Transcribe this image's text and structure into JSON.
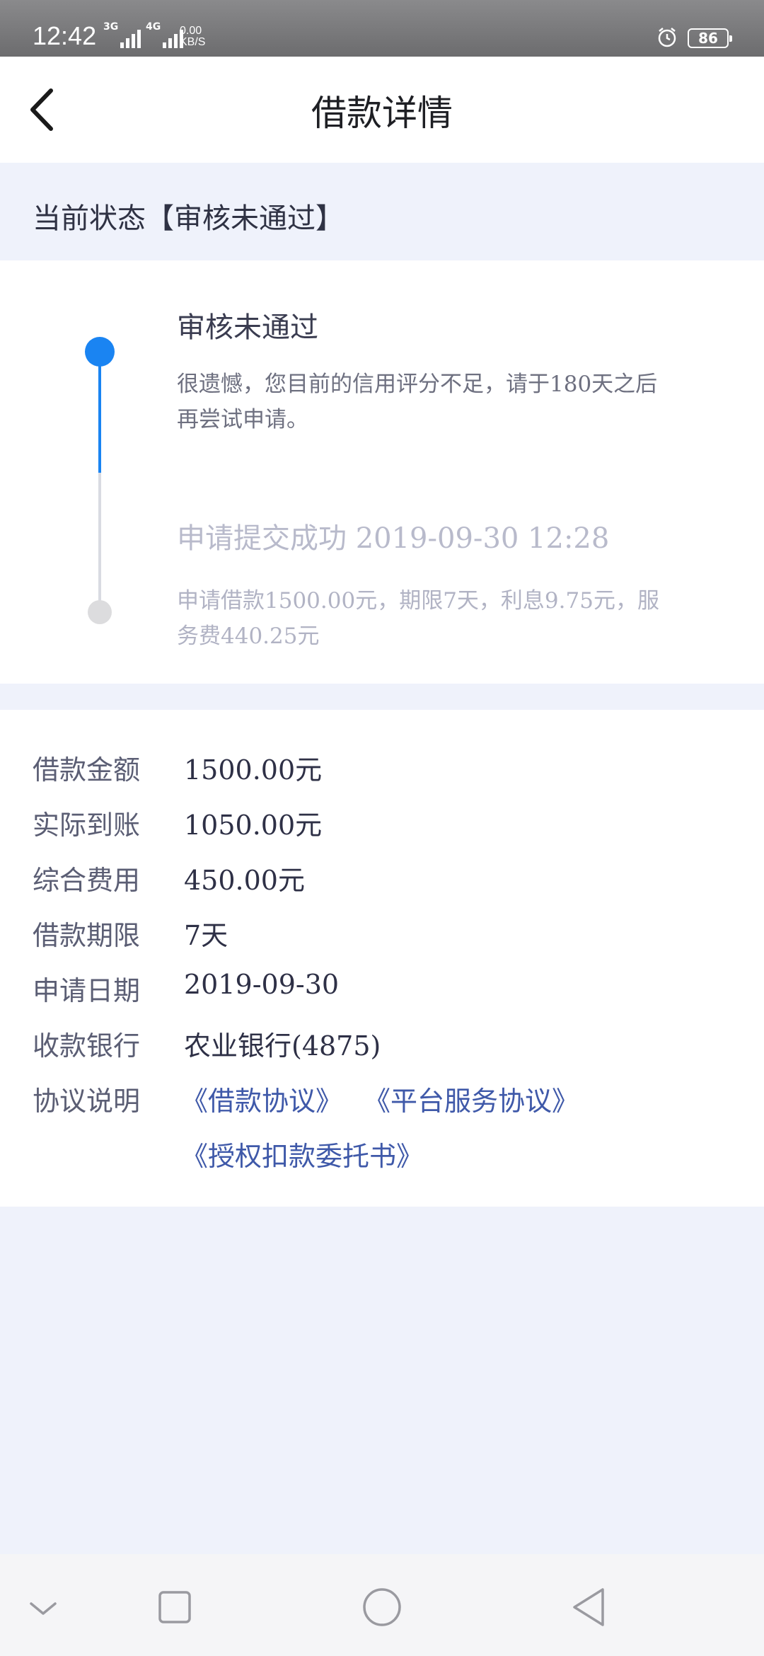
{
  "status_bar": {
    "time": "12:42",
    "network_1": "3G",
    "network_2": "4G",
    "speed_value": "0.00",
    "speed_unit": "KB/S",
    "battery": "86"
  },
  "header": {
    "title": "借款详情"
  },
  "state": {
    "text": "当前状态【审核未通过】"
  },
  "timeline": [
    {
      "title": "审核未通过",
      "desc": "很遗憾，您目前的信用评分不足，请于180天之后再尝试申请。",
      "active": true
    },
    {
      "title": "申请提交成功 2019-09-30 12:28",
      "desc": "申请借款1500.00元，期限7天，利息9.75元，服务费440.25元",
      "active": false
    }
  ],
  "details": [
    {
      "label": "借款金额",
      "value": "1500.00元"
    },
    {
      "label": "实际到账",
      "value": "1050.00元"
    },
    {
      "label": "综合费用",
      "value": "450.00元"
    },
    {
      "label": "借款期限",
      "value": "7天"
    },
    {
      "label": "申请日期",
      "value": "2019-09-30"
    },
    {
      "label": "收款银行",
      "value": "农业银行(4875)"
    }
  ],
  "agreements": {
    "label": "协议说明",
    "links": [
      "《借款协议》",
      "《平台服务协议》",
      "《授权扣款委托书》"
    ]
  },
  "colors": {
    "accent": "#1a84f2",
    "link": "#3f59a9",
    "background": "#eff2fb"
  },
  "nav_icons": [
    "chevron-down-icon",
    "square-icon",
    "circle-icon",
    "triangle-back-icon"
  ]
}
